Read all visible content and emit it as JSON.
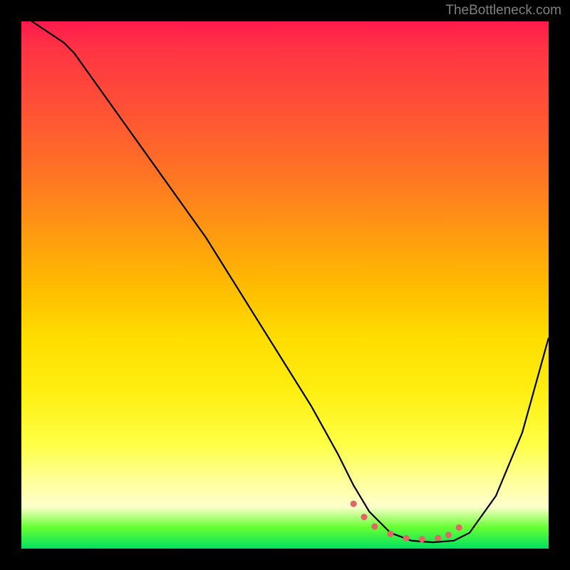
{
  "watermark": "TheBottleneck.com",
  "chart_data": {
    "type": "line",
    "title": "",
    "xlabel": "",
    "ylabel": "",
    "xlim": [
      0,
      100
    ],
    "ylim": [
      0,
      100
    ],
    "series": [
      {
        "name": "bottleneck-curve",
        "x": [
          0,
          2,
          8,
          10,
          15,
          20,
          25,
          30,
          35,
          40,
          45,
          50,
          55,
          60,
          63,
          66,
          70,
          74,
          78,
          82,
          85,
          90,
          95,
          100
        ],
        "values": [
          102,
          100,
          96,
          94,
          87,
          80,
          73,
          66,
          59,
          51,
          43,
          35,
          27,
          18,
          12,
          7,
          3,
          1.5,
          1.2,
          1.5,
          3,
          10,
          22,
          40
        ]
      }
    ],
    "markers": {
      "name": "optimal-range",
      "color": "#e06666",
      "points_x": [
        63,
        65,
        67,
        70,
        73,
        76,
        79,
        81,
        83
      ],
      "points_y": [
        8.5,
        6,
        4.2,
        2.8,
        2.0,
        1.8,
        2.0,
        2.6,
        4.0
      ]
    },
    "gradient_stops": [
      {
        "pos": 0,
        "color": "#ff1a4d"
      },
      {
        "pos": 50,
        "color": "#ffdd00"
      },
      {
        "pos": 92,
        "color": "#ffffcc"
      },
      {
        "pos": 100,
        "color": "#00e060"
      }
    ]
  }
}
